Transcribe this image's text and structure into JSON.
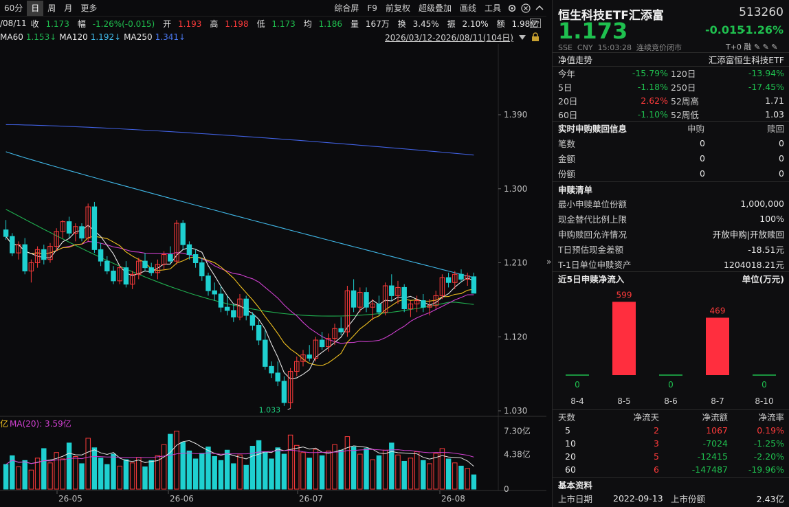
{
  "toolbar": {
    "periods": [
      "60分",
      "日",
      "周",
      "月",
      "更多"
    ],
    "selected": "日",
    "right_items": [
      "综合屏",
      "F9",
      "前复权",
      "超级叠加",
      "画线",
      "工具"
    ]
  },
  "info": {
    "date": "/08/11",
    "close_label": "收",
    "close": "1.173",
    "change_label": "幅",
    "change": "-1.26%(-0.015)",
    "open_label": "开",
    "open": "1.193",
    "high_label": "高",
    "high": "1.198",
    "low_label": "低",
    "low": "1.173",
    "avg_label": "均",
    "avg": "1.186",
    "vol_label": "量",
    "vol": "167万",
    "turn_label": "换",
    "turn": "3.45%",
    "amp_label": "振",
    "amp": "2.10%",
    "amt_label": "额",
    "amt": "1.98亿"
  },
  "ma": {
    "ma60_label": "MA60",
    "ma60": "1.153↓",
    "ma120_label": "MA120",
    "ma120": "1.192↓",
    "ma250_label": "MA250",
    "ma250": "1.341↓",
    "range": "2026/03/12-2026/08/11(104日)"
  },
  "axis": {
    "price_ticks": [
      "1.390",
      "1.300",
      "1.210",
      "1.120",
      "1.030"
    ],
    "low_marker": "1.033",
    "vol_label": "亿",
    "vol_ma_label": "MA(20): 3.59亿",
    "vol_ticks": [
      "7.30亿",
      "4.38亿",
      "0"
    ],
    "date_ticks": [
      "26-05",
      "26-06",
      "26-07",
      "26-08"
    ]
  },
  "colors": {
    "up": "#ff3b3b",
    "down": "#1fd0d0",
    "ma5": "#e6e6e6",
    "ma10": "#f0c020",
    "ma20": "#d040d0",
    "ma60": "#20b050",
    "ma120": "#40b8e8",
    "ma250": "#4060e0"
  },
  "panel": {
    "name": "恒生科技ETF汇添富",
    "code": "513260",
    "price": "1.173",
    "chg": "-0.015",
    "pct": "-1.26%",
    "exch": "SSE",
    "cur": "CNY",
    "time": "15:03:28",
    "status": "连续竞价闭市",
    "t0": "T+0",
    "rong": "融",
    "nav_title": "净值走势",
    "nav_index": "汇添富恒生科技ETF",
    "perf": [
      {
        "l1": "今年",
        "v1": "-15.79%",
        "c1": "green",
        "l2": "120日",
        "v2": "-13.94%",
        "c2": "green"
      },
      {
        "l1": "5日",
        "v1": "-1.18%",
        "c1": "green",
        "l2": "250日",
        "v2": "-17.45%",
        "c2": "green"
      },
      {
        "l1": "20日",
        "v1": "2.62%",
        "c1": "red",
        "l2": "52周高",
        "v2": "1.71",
        "c2": "white"
      },
      {
        "l1": "60日",
        "v1": "-1.10%",
        "c1": "green",
        "l2": "52周低",
        "v2": "1.03",
        "c2": "white"
      }
    ],
    "rt_title": "实时申购赎回信息",
    "rt_sub": "申购",
    "rt_red": "赎回",
    "rt_rows": [
      {
        "label": "笔数",
        "a": "0",
        "b": "0"
      },
      {
        "label": "金额",
        "a": "0",
        "b": "0"
      },
      {
        "label": "份额",
        "a": "0",
        "b": "0"
      }
    ],
    "list_title": "申赎清单",
    "list_rows": [
      {
        "label": "最小申赎单位份额",
        "value": "1,000,000"
      },
      {
        "label": "现金替代比例上限",
        "value": "100%"
      },
      {
        "label": "申购赎回允许情况",
        "value": "开放申购|开放赎回"
      },
      {
        "label": "T日预估现金差额",
        "value": "-18.51元"
      },
      {
        "label": "T-1日单位申赎资产",
        "value": "1204018.21元"
      }
    ],
    "flow_title": "近5日申赎净流入",
    "flow_unit": "单位(万元)",
    "flow_bars": [
      {
        "date": "8-4",
        "value": 0
      },
      {
        "date": "8-5",
        "value": 599
      },
      {
        "date": "8-6",
        "value": 0
      },
      {
        "date": "8-7",
        "value": 469
      },
      {
        "date": "8-10",
        "value": 0
      }
    ],
    "stat_headers": [
      "天数",
      "净流天",
      "净流额",
      "净流率"
    ],
    "stat_rows": [
      {
        "d": "5",
        "n": "2",
        "amt": "1067",
        "rate": "0.19%"
      },
      {
        "d": "10",
        "n": "3",
        "amt": "-7024",
        "rate": "-1.25%"
      },
      {
        "d": "20",
        "n": "5",
        "amt": "-12415",
        "rate": "-2.20%"
      },
      {
        "d": "60",
        "n": "6",
        "amt": "-147487",
        "rate": "-19.96%"
      }
    ],
    "basic_title": "基本资料",
    "listing_label": "上市日期",
    "listing_date": "2022-09-13",
    "shares_label": "上市份额",
    "shares": "2.43亿"
  },
  "chart_data": {
    "type": "candlestick",
    "date_range": [
      "2026-03-12",
      "2026-08-11"
    ],
    "last_candle": {
      "open": 1.193,
      "high": 1.198,
      "low": 1.173,
      "close": 1.173
    },
    "period_low": 1.033,
    "ma_last": {
      "MA60": 1.153,
      "MA120": 1.192,
      "MA250": 1.341
    },
    "y_ticks": [
      1.39,
      1.3,
      1.21,
      1.12,
      1.03
    ],
    "ohlc": [
      [
        1.25,
        1.262,
        1.238,
        1.242
      ],
      [
        1.242,
        1.246,
        1.218,
        1.222
      ],
      [
        1.222,
        1.236,
        1.214,
        1.232
      ],
      [
        1.232,
        1.24,
        1.196,
        1.2
      ],
      [
        1.2,
        1.214,
        1.186,
        1.21
      ],
      [
        1.21,
        1.23,
        1.204,
        1.226
      ],
      [
        1.226,
        1.232,
        1.208,
        1.214
      ],
      [
        1.214,
        1.234,
        1.21,
        1.23
      ],
      [
        1.23,
        1.252,
        1.224,
        1.248
      ],
      [
        1.248,
        1.262,
        1.24,
        1.26
      ],
      [
        1.26,
        1.266,
        1.24,
        1.246
      ],
      [
        1.246,
        1.258,
        1.236,
        1.254
      ],
      [
        1.254,
        1.258,
        1.236,
        1.24
      ],
      [
        1.24,
        1.282,
        1.236,
        1.278
      ],
      [
        1.278,
        1.284,
        1.222,
        1.226
      ],
      [
        1.226,
        1.234,
        1.206,
        1.212
      ],
      [
        1.212,
        1.218,
        1.196,
        1.2
      ],
      [
        1.2,
        1.206,
        1.184,
        1.188
      ],
      [
        1.188,
        1.208,
        1.184,
        1.204
      ],
      [
        1.204,
        1.212,
        1.18,
        1.184
      ],
      [
        1.184,
        1.2,
        1.178,
        1.196
      ],
      [
        1.196,
        1.216,
        1.19,
        1.212
      ],
      [
        1.212,
        1.222,
        1.2,
        1.204
      ],
      [
        1.204,
        1.21,
        1.194,
        1.198
      ],
      [
        1.198,
        1.214,
        1.19,
        1.208
      ],
      [
        1.208,
        1.224,
        1.202,
        1.22
      ],
      [
        1.22,
        1.23,
        1.208,
        1.212
      ],
      [
        1.212,
        1.262,
        1.208,
        1.258
      ],
      [
        1.258,
        1.262,
        1.226,
        1.232
      ],
      [
        1.232,
        1.236,
        1.214,
        1.22
      ],
      [
        1.22,
        1.226,
        1.204,
        1.21
      ],
      [
        1.21,
        1.216,
        1.188,
        1.194
      ],
      [
        1.194,
        1.198,
        1.17,
        1.176
      ],
      [
        1.176,
        1.186,
        1.164,
        1.172
      ],
      [
        1.172,
        1.182,
        1.15,
        1.156
      ],
      [
        1.156,
        1.17,
        1.146,
        1.152
      ],
      [
        1.152,
        1.16,
        1.138,
        1.144
      ],
      [
        1.144,
        1.172,
        1.14,
        1.166
      ],
      [
        1.166,
        1.17,
        1.14,
        1.146
      ],
      [
        1.146,
        1.15,
        1.128,
        1.134
      ],
      [
        1.134,
        1.14,
        1.11,
        1.116
      ],
      [
        1.116,
        1.128,
        1.08,
        1.084
      ],
      [
        1.084,
        1.09,
        1.07,
        1.076
      ],
      [
        1.076,
        1.09,
        1.06,
        1.066
      ],
      [
        1.066,
        1.072,
        1.036,
        1.04
      ],
      [
        1.04,
        1.082,
        1.033,
        1.078
      ],
      [
        1.078,
        1.096,
        1.072,
        1.09
      ],
      [
        1.09,
        1.104,
        1.084,
        1.098
      ],
      [
        1.098,
        1.11,
        1.09,
        1.094
      ],
      [
        1.094,
        1.12,
        1.09,
        1.116
      ],
      [
        1.116,
        1.126,
        1.104,
        1.108
      ],
      [
        1.108,
        1.124,
        1.102,
        1.118
      ],
      [
        1.118,
        1.136,
        1.11,
        1.13
      ],
      [
        1.13,
        1.144,
        1.122,
        1.126
      ],
      [
        1.126,
        1.182,
        1.12,
        1.176
      ],
      [
        1.176,
        1.19,
        1.15,
        1.156
      ],
      [
        1.156,
        1.18,
        1.15,
        1.174
      ],
      [
        1.174,
        1.18,
        1.15,
        1.156
      ],
      [
        1.156,
        1.166,
        1.14,
        1.16
      ],
      [
        1.16,
        1.17,
        1.146,
        1.15
      ],
      [
        1.15,
        1.186,
        1.146,
        1.182
      ],
      [
        1.182,
        1.196,
        1.164,
        1.17
      ],
      [
        1.17,
        1.188,
        1.16,
        1.18
      ],
      [
        1.18,
        1.184,
        1.15,
        1.154
      ],
      [
        1.154,
        1.164,
        1.144,
        1.16
      ],
      [
        1.16,
        1.17,
        1.15,
        1.164
      ],
      [
        1.164,
        1.172,
        1.15,
        1.156
      ],
      [
        1.156,
        1.166,
        1.146,
        1.158
      ],
      [
        1.158,
        1.176,
        1.154,
        1.17
      ],
      [
        1.17,
        1.196,
        1.166,
        1.192
      ],
      [
        1.192,
        1.198,
        1.18,
        1.186
      ],
      [
        1.186,
        1.2,
        1.178,
        1.196
      ],
      [
        1.196,
        1.202,
        1.186,
        1.19
      ],
      [
        1.19,
        1.198,
        1.182,
        1.194
      ],
      [
        1.193,
        1.198,
        1.173,
        1.173
      ]
    ],
    "volume": [
      3.1,
      4.2,
      2.8,
      3.6,
      2.4,
      3.9,
      5.1,
      3.3,
      4.6,
      3.8,
      5.8,
      4.1,
      3.2,
      6.4,
      5.2,
      3.9,
      3.1,
      4.4,
      2.9,
      3.7,
      3.3,
      4.0,
      2.8,
      3.6,
      4.2,
      5.6,
      6.9,
      7.3,
      5.9,
      4.8,
      3.8,
      4.5,
      5.3,
      4.1,
      3.6,
      4.9,
      3.2,
      4.3,
      3.0,
      5.4,
      6.1,
      4.7,
      3.8,
      5.2,
      4.4,
      6.8,
      5.5,
      4.6,
      3.9,
      5.0,
      4.2,
      4.8,
      5.6,
      4.9,
      6.6,
      5.3,
      4.4,
      5.1,
      3.7,
      4.2,
      4.9,
      5.8,
      4.3,
      3.5,
      3.9,
      4.7,
      3.6,
      3.2,
      4.5,
      5.1,
      3.8,
      3.3,
      2.9,
      2.6,
      1.8
    ]
  }
}
